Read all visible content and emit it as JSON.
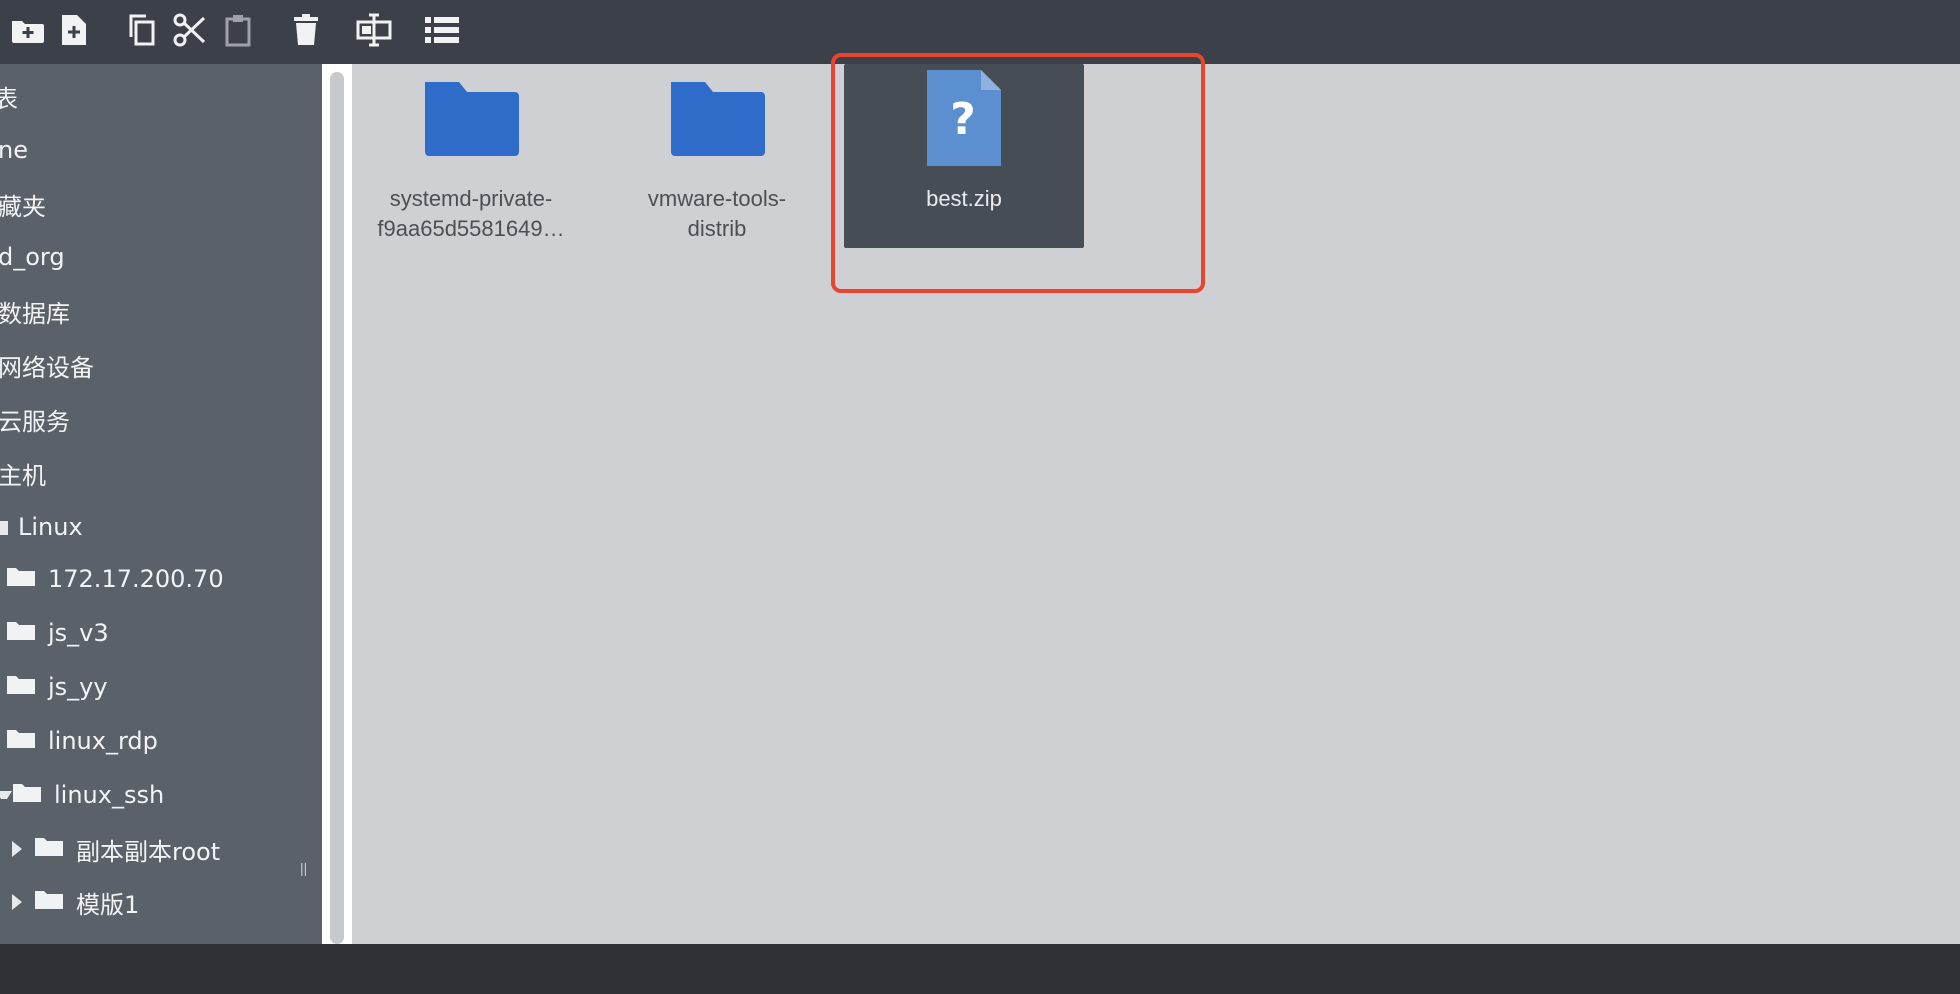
{
  "toolbar": {
    "buttons": [
      {
        "name": "new-folder"
      },
      {
        "name": "new-file"
      },
      {
        "name": "copy"
      },
      {
        "name": "cut"
      },
      {
        "name": "paste"
      },
      {
        "name": "delete"
      },
      {
        "name": "rename"
      },
      {
        "name": "list-view"
      }
    ]
  },
  "sidebar": {
    "items": [
      {
        "label": "表"
      },
      {
        "label": "ne"
      },
      {
        "label": "藏夹"
      },
      {
        "label": "d_org"
      },
      {
        "label": "数据库"
      },
      {
        "label": "网络设备"
      },
      {
        "label": "云服务"
      },
      {
        "label": "主机"
      },
      {
        "label": "Linux"
      },
      {
        "label": "172.17.200.70"
      },
      {
        "label": "js_v3"
      },
      {
        "label": "js_yy"
      },
      {
        "label": "linux_rdp"
      },
      {
        "label": "linux_ssh"
      },
      {
        "label": "副本副本root"
      },
      {
        "label": "模版1"
      }
    ]
  },
  "files": [
    {
      "label_line1": "systemd-private-",
      "label_line2": "f9aa65d5581649…",
      "type": "folder"
    },
    {
      "label_line1": "vmware-tools-",
      "label_line2": "distrib",
      "type": "folder"
    },
    {
      "label_line1": "best.zip",
      "label_line2": "",
      "type": "unknown-file",
      "selected": true
    }
  ],
  "colors": {
    "accent": "#e8442f",
    "folder": "#2f6bc8",
    "file": "#5b8fd0"
  }
}
